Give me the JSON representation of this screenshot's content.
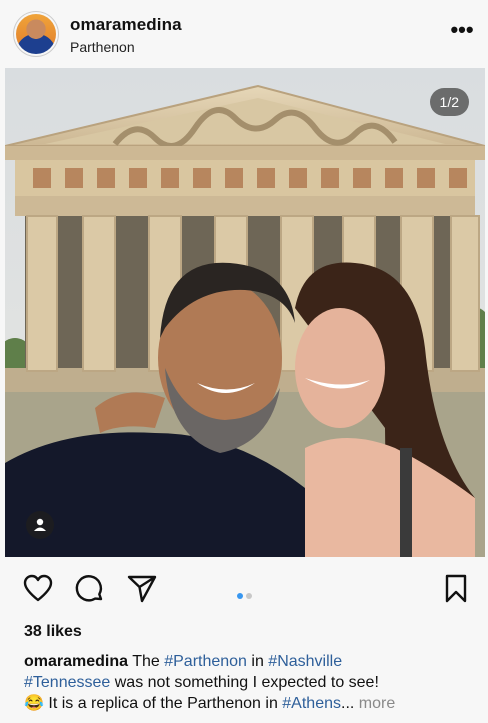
{
  "post": {
    "username": "omaramedina",
    "location": "Parthenon",
    "image_counter": "1/2",
    "likes": "38 likes",
    "caption": {
      "username": "omaramedina",
      "t1": " The ",
      "h1": "#Parthenon",
      "t2": " in ",
      "h2": "#Nashville",
      "h3": "#Tennessee",
      "t3": " was not something I expected to see!",
      "emoji": "😂",
      "t4": " It is a replica of the Parthenon in ",
      "h4": "#Athens",
      "t5": "... ",
      "more": "more"
    }
  },
  "icons": {
    "more": "more-options-icon",
    "like": "heart-icon",
    "comment": "comment-icon",
    "share": "share-icon",
    "save": "bookmark-icon",
    "tagged": "person-tag-icon"
  },
  "colors": {
    "hashtag": "#2e5f9a",
    "active_dot": "#3897f0",
    "inactive_dot": "#c8c8c8"
  }
}
